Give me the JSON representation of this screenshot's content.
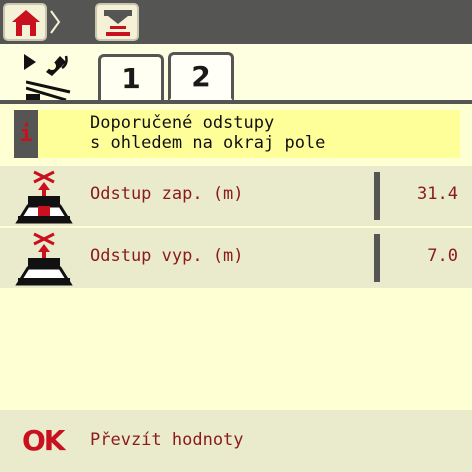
{
  "nav": {
    "home_icon": "home-icon",
    "separator_icon": "chevron-right-icon",
    "settings_icon": "spreader-settings-icon"
  },
  "side_icons": [
    "gps-signal-icon",
    "field-border-icon"
  ],
  "tabs": [
    {
      "label": "1",
      "active": false
    },
    {
      "label": "2",
      "active": true
    }
  ],
  "info": {
    "marker": "i",
    "line1": "Doporučené odstupy",
    "line2": "s ohledem na okraj pole"
  },
  "rows": [
    {
      "label": "Odstup zap. (m)",
      "value": "31.4",
      "icon": "spreader-on-distance-icon"
    },
    {
      "label": "Odstup vyp. (m)",
      "value": "7.0",
      "icon": "spreader-off-distance-icon"
    }
  ],
  "ok": {
    "mark": "OK",
    "label": "Převzít hodnoty"
  },
  "colors": {
    "accent": "#c8101e",
    "text_red": "#8b1a1a",
    "bar": "#555654",
    "background": "#ffffd4",
    "info_bg": "#ffff99"
  }
}
